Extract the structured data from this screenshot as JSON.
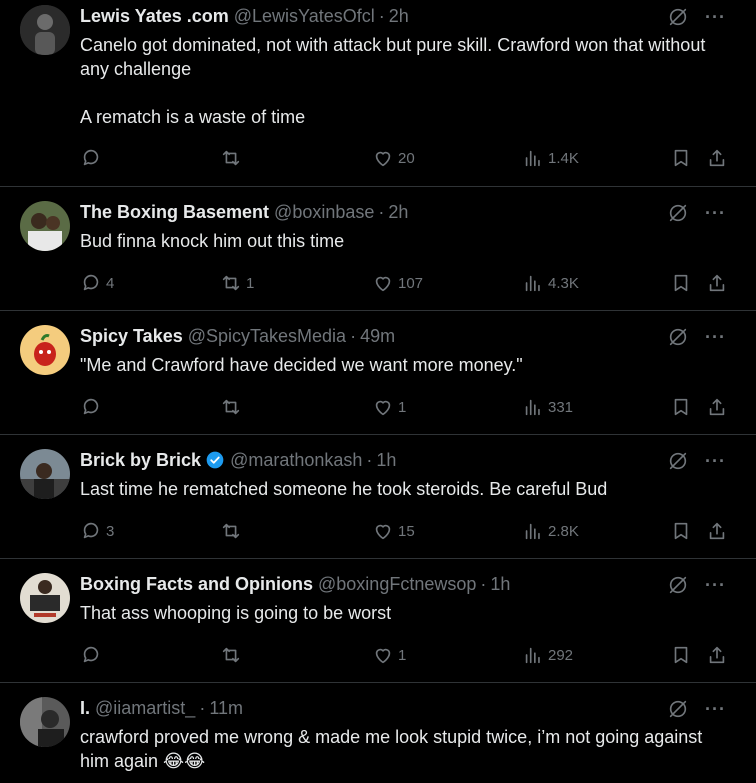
{
  "tweets": [
    {
      "name": "Lewis Yates .com",
      "handle": "@LewisYatesOfcl",
      "time": "2h",
      "verified": false,
      "text": "Canelo got dominated, not with attack but pure skill. Crawford won that without any challenge\n\nA rematch is a waste of time",
      "replies": "",
      "reposts": "",
      "likes": "20",
      "views": "1.4K",
      "avatar_color": "#3a3a3a"
    },
    {
      "name": "The Boxing Basement",
      "handle": "@boxinbase",
      "time": "2h",
      "verified": false,
      "text": "Bud finna knock him out this time",
      "replies": "4",
      "reposts": "1",
      "likes": "107",
      "views": "4.3K",
      "avatar_color": "#4a5a3a"
    },
    {
      "name": "Spicy Takes",
      "handle": "@SpicyTakesMedia",
      "time": "49m",
      "verified": false,
      "text": "\"Me and Crawford have decided we want more money.\"",
      "replies": "",
      "reposts": "",
      "likes": "1",
      "views": "331",
      "avatar_color": "#f2c77a"
    },
    {
      "name": "Brick by Brick",
      "handle": "@marathonkash",
      "time": "1h",
      "verified": true,
      "text": "Last time he rematched someone he took steroids. Be careful Bud",
      "replies": "3",
      "reposts": "",
      "likes": "15",
      "views": "2.8K",
      "avatar_color": "#6a6a6a"
    },
    {
      "name": "Boxing Facts and Opinions",
      "handle": "@boxingFctnewsop",
      "time": "1h",
      "verified": false,
      "text": "That ass whooping is going to be worst",
      "replies": "",
      "reposts": "",
      "likes": "1",
      "views": "292",
      "avatar_color": "#d9d4c8"
    },
    {
      "name": "I.",
      "handle": "@iiamartist_",
      "time": "11m",
      "verified": false,
      "text": "crawford proved me wrong & made me look stupid twice, i’m not going against him again 😂😂",
      "replies": "",
      "reposts": "",
      "likes": "",
      "views": "",
      "avatar_color": "#4a4a4a"
    }
  ],
  "colors": {
    "background": "#000000",
    "text": "#e7e9ea",
    "muted": "#71767b",
    "border": "#2f3336",
    "verified": "#1d9bf0"
  }
}
